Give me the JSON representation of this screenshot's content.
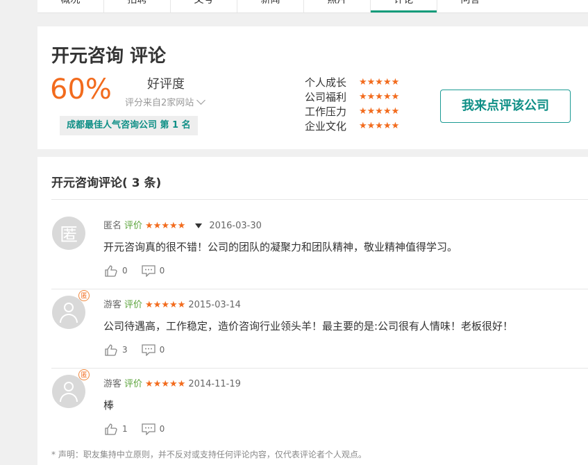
{
  "topnav": {
    "tabs": [
      {
        "label": "概况",
        "active": false
      },
      {
        "label": "招聘",
        "active": false
      },
      {
        "label": "文号",
        "active": false
      },
      {
        "label": "新闻",
        "active": false
      },
      {
        "label": "照片",
        "active": false
      },
      {
        "label": "评论",
        "active": true
      },
      {
        "label": "问答",
        "active": false
      }
    ]
  },
  "summary": {
    "title": "开元咨询 评论",
    "rate": "60%",
    "rate_label": "好评度",
    "source": "评分来自2家网站",
    "rank": "成都最佳人气咨询公司 第 1 名",
    "ratings": [
      {
        "label": "个人成长",
        "stars": "★★★★★"
      },
      {
        "label": "公司福利",
        "stars": "★★★★★"
      },
      {
        "label": "工作压力",
        "stars": "★★★★★"
      },
      {
        "label": "企业文化",
        "stars": "★★★★★"
      }
    ],
    "cta": "我来点评该公司"
  },
  "reviews": {
    "title": "开元咨询评论(",
    "count": " 3 条)",
    "items": [
      {
        "avatar_text": "匿",
        "author": "匿名",
        "tag": "评价",
        "stars": "★★★★★",
        "date": "2016-03-30",
        "content": "开元咨询真的很不错！公司的团队的凝聚力和团队精神，敬业精神值得学习。",
        "likes": "0",
        "comments": "0"
      },
      {
        "badge": "匿",
        "author": "游客",
        "tag": "评价",
        "stars": "★★★★★",
        "date": "2015-03-14",
        "content": "公司待遇高，工作稳定，造价咨询行业领头羊！最主要的是:公司很有人情味！老板很好！",
        "likes": "3",
        "comments": "0"
      },
      {
        "badge": "匿",
        "author": "游客",
        "tag": "评价",
        "stars": "★★★★★",
        "date": "2014-11-19",
        "content": "棒",
        "likes": "1",
        "comments": "0"
      }
    ],
    "disclaimer": "* 声明：职友集持中立原则，并不反对或支持任何评论内容，仅代表评论者个人观点。"
  },
  "colors": {
    "accent": "#f26b1d",
    "brand": "#0f8f86",
    "tag": "#5aa33a"
  }
}
